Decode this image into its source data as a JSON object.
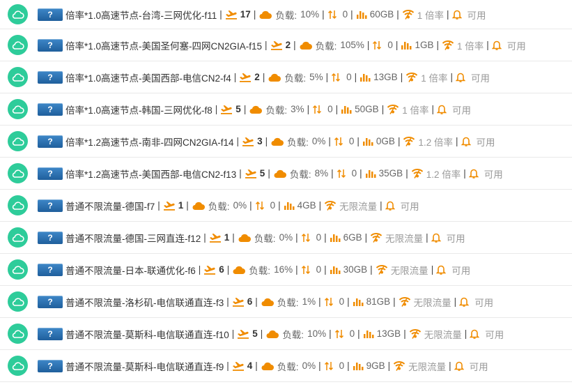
{
  "colors": {
    "status": "#2ecc9a",
    "accent": "#f08c00",
    "flag": "#2a6fb0"
  },
  "flag_text": "?",
  "nodes": [
    {
      "name": "倍率*1.0高速节点-台湾-三网优化-f11",
      "users": "17",
      "load_label": "负载:",
      "load": "10%",
      "updown": "0",
      "traffic": "60GB",
      "rate": "1 倍率",
      "status": "可用"
    },
    {
      "name": "倍率*1.0高速节点-美国圣何塞-四网CN2GIA-f15",
      "users": "2",
      "load_label": "负载:",
      "load": "105%",
      "updown": "0",
      "traffic": "1GB",
      "rate": "1 倍率",
      "status": "可用"
    },
    {
      "name": "倍率*1.0高速节点-美国西部-电信CN2-f4",
      "users": "2",
      "load_label": "负载:",
      "load": "5%",
      "updown": "0",
      "traffic": "13GB",
      "rate": "1 倍率",
      "status": "可用"
    },
    {
      "name": "倍率*1.0高速节点-韩国-三网优化-f8",
      "users": "5",
      "load_label": "负载:",
      "load": "3%",
      "updown": "0",
      "traffic": "50GB",
      "rate": "1 倍率",
      "status": "可用"
    },
    {
      "name": "倍率*1.2高速节点-南非-四网CN2GIA-f14",
      "users": "3",
      "load_label": "负载:",
      "load": "0%",
      "updown": "0",
      "traffic": "0GB",
      "rate": "1.2 倍率",
      "status": "可用"
    },
    {
      "name": "倍率*1.2高速节点-美国西部-电信CN2-f13",
      "users": "5",
      "load_label": "负载:",
      "load": "8%",
      "updown": "0",
      "traffic": "35GB",
      "rate": "1.2 倍率",
      "status": "可用"
    },
    {
      "name": "普通不限流量-德国-f7",
      "users": "1",
      "load_label": "负载:",
      "load": "0%",
      "updown": "0",
      "traffic": "4GB",
      "rate": "无限流量",
      "status": "可用"
    },
    {
      "name": "普通不限流量-德国-三网直连-f12",
      "users": "1",
      "load_label": "负载:",
      "load": "0%",
      "updown": "0",
      "traffic": "6GB",
      "rate": "无限流量",
      "status": "可用"
    },
    {
      "name": "普通不限流量-日本-联通优化-f6",
      "users": "6",
      "load_label": "负载:",
      "load": "16%",
      "updown": "0",
      "traffic": "30GB",
      "rate": "无限流量",
      "status": "可用"
    },
    {
      "name": "普通不限流量-洛杉矶-电信联通直连-f3",
      "users": "6",
      "load_label": "负载:",
      "load": "1%",
      "updown": "0",
      "traffic": "81GB",
      "rate": "无限流量",
      "status": "可用"
    },
    {
      "name": "普通不限流量-莫斯科-电信联通直连-f10",
      "users": "5",
      "load_label": "负载:",
      "load": "10%",
      "updown": "0",
      "traffic": "13GB",
      "rate": "无限流量",
      "status": "可用"
    },
    {
      "name": "普通不限流量-莫斯科-电信联通直连-f9",
      "users": "4",
      "load_label": "负载:",
      "load": "0%",
      "updown": "0",
      "traffic": "9GB",
      "rate": "无限流量",
      "status": "可用"
    }
  ]
}
